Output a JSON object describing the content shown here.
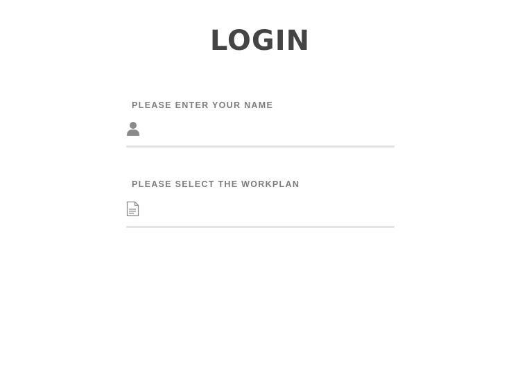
{
  "page": {
    "title": "LOGIN"
  },
  "form": {
    "name_field": {
      "label": "PLEASE ENTER YOUR NAME",
      "value": "",
      "icon": "user-icon"
    },
    "workplan_field": {
      "label": "PLEASE SELECT THE WORKPLAN",
      "value": "",
      "icon": "document-icon"
    }
  },
  "colors": {
    "title": "#444444",
    "label": "#7c7c7c",
    "icon": "#8a8a8a",
    "underline": "#e3e3e3",
    "background": "#ffffff"
  }
}
